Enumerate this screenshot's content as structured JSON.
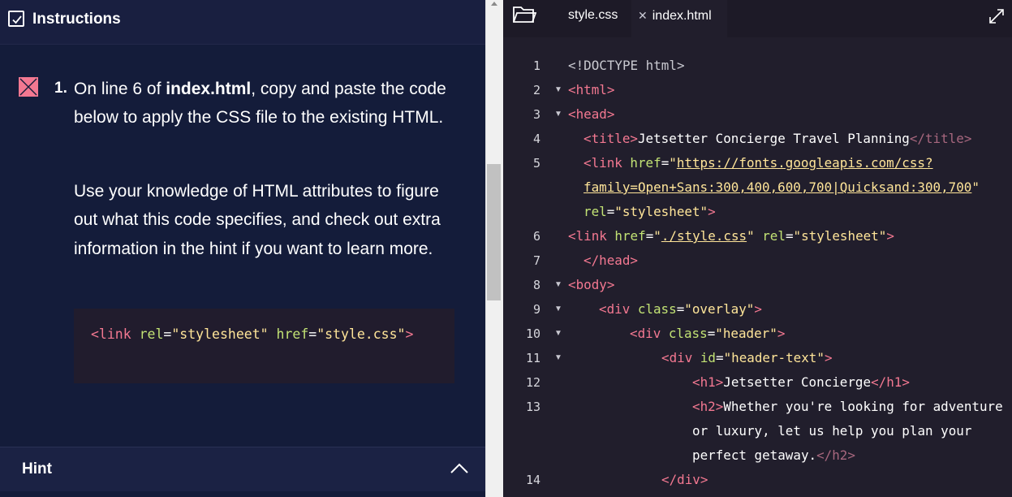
{
  "instructions": {
    "title": "Instructions",
    "task": {
      "number": "1.",
      "text_before": "On line 6 of ",
      "text_bold": "index.html",
      "text_after": ", copy and paste the code below to apply the CSS file to the existing HTML.",
      "paragraph2": "Use your knowledge of HTML attributes to figure out what this code specifies, and check out extra information in the hint if you want to learn more.",
      "snippet": {
        "open": "<link ",
        "attr1": "rel",
        "eq1": "=",
        "val1": "\"stylesheet\"",
        "attr2": " href",
        "eq2": "=",
        "val2": "\"style.css\"",
        "close": ">"
      }
    },
    "hint_label": "Hint"
  },
  "editor": {
    "tabs": [
      {
        "label": "style.css",
        "active": false
      },
      {
        "label": "index.html",
        "active": true
      }
    ],
    "close_glyph": "✕",
    "lines": [
      {
        "n": "1",
        "parts": [
          "<!DOCTYPE html>"
        ]
      },
      {
        "n": "2",
        "parts": [
          "<html>"
        ]
      },
      {
        "n": "3",
        "parts": [
          "<head>"
        ]
      },
      {
        "n": "4",
        "parts": [
          "<title>",
          "Jetsetter Concierge Travel Planning",
          "</title>"
        ]
      },
      {
        "n": "5",
        "parts": [
          "<link ",
          "href",
          "=",
          "\"",
          "https://fonts.googleapis.com/css?",
          "family=Open+Sans:300,400,600,700|Quicksand:300,700",
          "\"",
          "rel",
          "=",
          "\"stylesheet\"",
          ">"
        ]
      },
      {
        "n": "6",
        "parts": [
          "<link ",
          "href",
          "=",
          "\"",
          "./style.css",
          "\"",
          " rel",
          "=",
          "\"stylesheet\"",
          ">"
        ]
      },
      {
        "n": "7",
        "parts": [
          "</head>"
        ]
      },
      {
        "n": "8",
        "parts": [
          "<body>"
        ]
      },
      {
        "n": "9",
        "parts": [
          "<div ",
          "class",
          "=",
          "\"overlay\"",
          ">"
        ]
      },
      {
        "n": "10",
        "parts": [
          "<div ",
          "class",
          "=",
          "\"header\"",
          ">"
        ]
      },
      {
        "n": "11",
        "parts": [
          "<div ",
          "id",
          "=",
          "\"header-text\"",
          ">"
        ]
      },
      {
        "n": "12",
        "parts": [
          "<h1>",
          "Jetsetter Concierge",
          "</h1>"
        ]
      },
      {
        "n": "13",
        "parts": [
          "<h2>",
          "Whether you're looking for adventure",
          "or luxury, let us help you plan your",
          "perfect getaway.",
          "</h2>"
        ]
      },
      {
        "n": "14",
        "parts": [
          "</div>"
        ]
      }
    ]
  },
  "colors": {
    "left_bg": "#141c3a",
    "editor_bg": "#211e2c",
    "tag": "#f37891",
    "attr": "#c2e274",
    "string": "#ffe599",
    "status_incomplete": "#f37891"
  },
  "icons": [
    "checkbox-icon",
    "x-mark-icon",
    "chevron-up-icon",
    "folder-icon",
    "close-icon",
    "expand-icon",
    "fold-arrow-icon"
  ]
}
